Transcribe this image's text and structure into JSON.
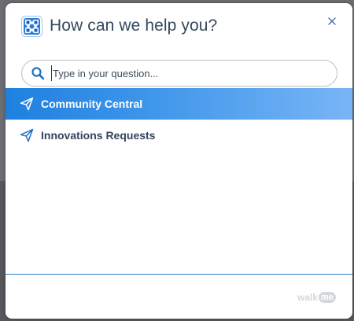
{
  "header": {
    "title": "How can we help you?",
    "logo_icon": "life-ring-icon",
    "close_icon": "close-icon"
  },
  "search": {
    "placeholder": "Type in your question...",
    "value": "",
    "icon": "search-icon"
  },
  "menu": {
    "items": [
      {
        "label": "Community Central",
        "icon": "paper-plane-icon",
        "selected": true
      },
      {
        "label": "Innovations Requests",
        "icon": "paper-plane-icon",
        "selected": false
      }
    ]
  },
  "footer": {
    "brand_text": "walk",
    "brand_badge": "me"
  },
  "colors": {
    "accent": "#1f80e0",
    "title_text": "#34495e",
    "divider": "#2f7fd0"
  }
}
